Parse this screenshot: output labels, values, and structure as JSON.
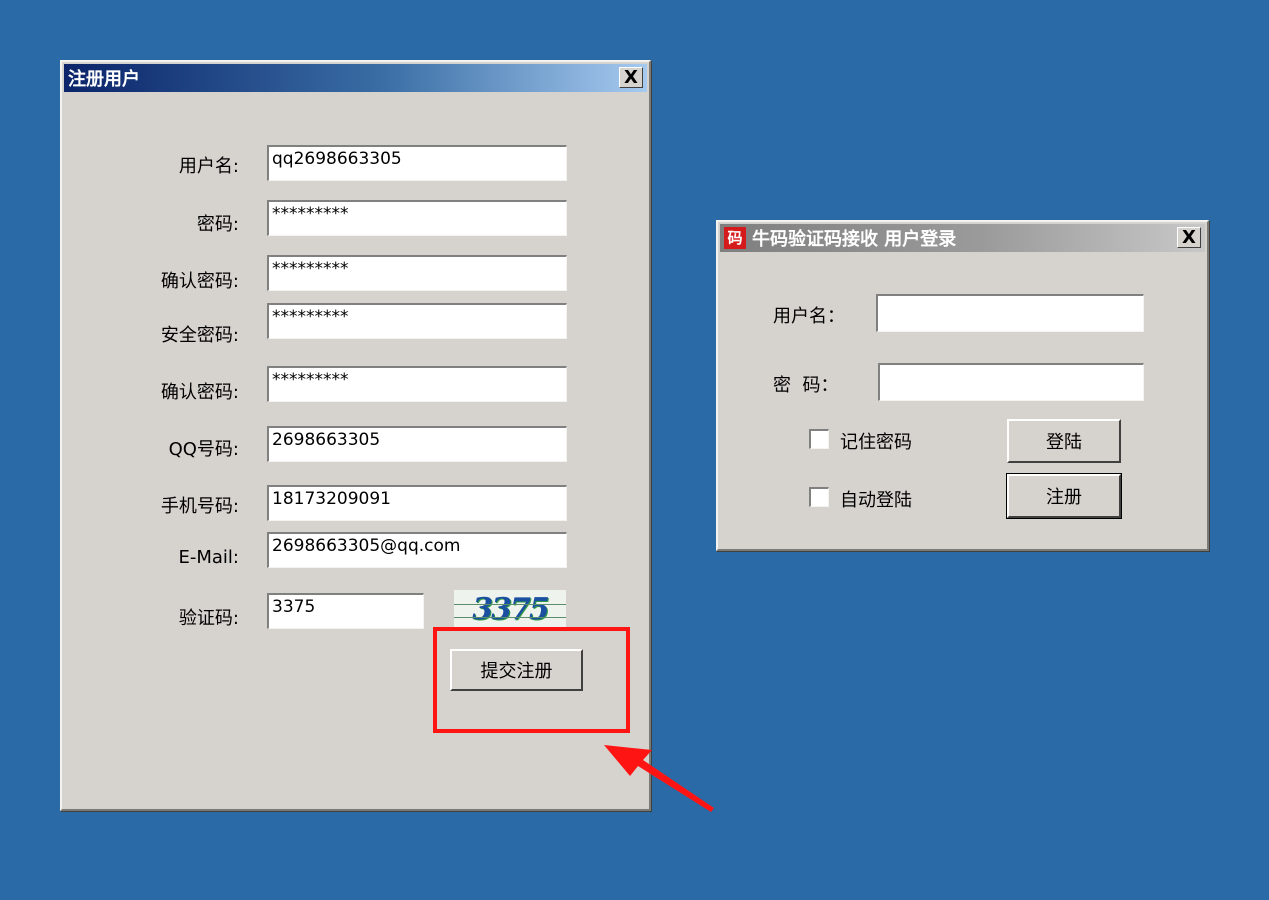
{
  "register_window": {
    "title": "注册用户",
    "close_label": "X",
    "fields": {
      "username": {
        "label": "用户名:",
        "value": "qq2698663305"
      },
      "password": {
        "label": "密码:",
        "value": "*********"
      },
      "confirm_password": {
        "label": "确认密码:",
        "value": "*********"
      },
      "security_password": {
        "label": "安全密码:",
        "value": "*********"
      },
      "confirm_security_password": {
        "label": "确认密码:",
        "value": "*********"
      },
      "qq": {
        "label": "QQ号码:",
        "value": "2698663305"
      },
      "phone": {
        "label": "手机号码:",
        "value": "18173209091"
      },
      "email": {
        "label": "E-Mail:",
        "value": "2698663305@qq.com"
      },
      "captcha": {
        "label": "验证码:",
        "value": "3375"
      }
    },
    "captcha_image_text": "3375",
    "submit_label": "提交注册"
  },
  "login_window": {
    "title": "牛码验证码接收 用户登录",
    "app_icon_glyph": "码",
    "close_label": "X",
    "username_label": "用户名：",
    "username_value": "",
    "password_label": "密  码：",
    "password_value": "",
    "remember_label": "记住密码",
    "auto_login_label": "自动登陆",
    "login_label": "登陆",
    "register_label": "注册"
  },
  "colors": {
    "desktop": "#2a6aa6",
    "window_face": "#d6d3ce",
    "highlight": "#ff1414"
  }
}
